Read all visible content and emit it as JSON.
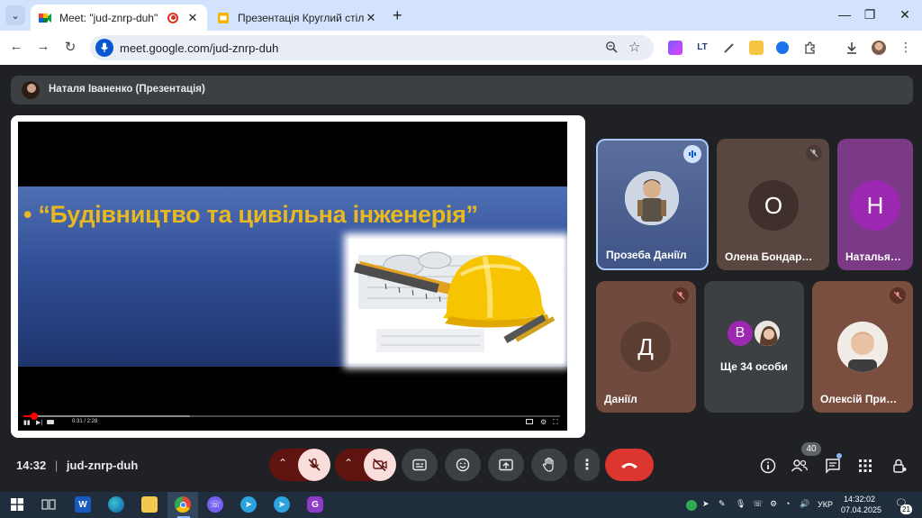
{
  "browser": {
    "tabs": [
      {
        "title": "Meet: \"jud-znrp-duh\"",
        "close": "✕"
      },
      {
        "title": "Презентація Круглий стіл «Мо",
        "close": "✕"
      }
    ],
    "new_tab": "+",
    "url": "meet.google.com/jud-znrp-duh",
    "window_controls": {
      "minimize": "—",
      "restore": "❐",
      "close": "✕"
    }
  },
  "meet": {
    "presenter_label": "Наталя Іваненко (Презентація)",
    "slide_title": "• “Будівництво та цивільна інженерія”",
    "player_time": "0:31 / 2:28",
    "progress": {
      "watched": 0.02,
      "loaded": 0.31
    },
    "participants": [
      {
        "name": "Прозеба Даніїл",
        "speaking": true
      },
      {
        "name": "Олена Бондар…",
        "initial": "О",
        "avatar_color": "#4a3a36",
        "muted": true
      },
      {
        "name": "Наталья…",
        "initial": "Н",
        "avatar_color": "#9c27b0"
      },
      {
        "name": "Даніїл",
        "initial": "Д",
        "avatar_color": "#6b4a3c",
        "muted": true
      },
      {
        "name": "Ще 34 особи",
        "initial": "В",
        "avatar_color": "#9c27b0"
      },
      {
        "name": "Олексій При…",
        "muted": true
      }
    ],
    "meeting_time": "14:32",
    "meeting_code": "jud-znrp-duh",
    "people_count": "40"
  },
  "taskbar": {
    "lang": "УКР",
    "time": "14:32:02",
    "date": "07.04.2025",
    "notifications": "21",
    "word_letter": "W",
    "ai_letter": "G"
  },
  "colors": {
    "accent_red": "#ea4335",
    "mic_off_bg": "#f9dedc",
    "mic_off_dark": "#601410",
    "active_tile_border": "#a8c7fa"
  }
}
